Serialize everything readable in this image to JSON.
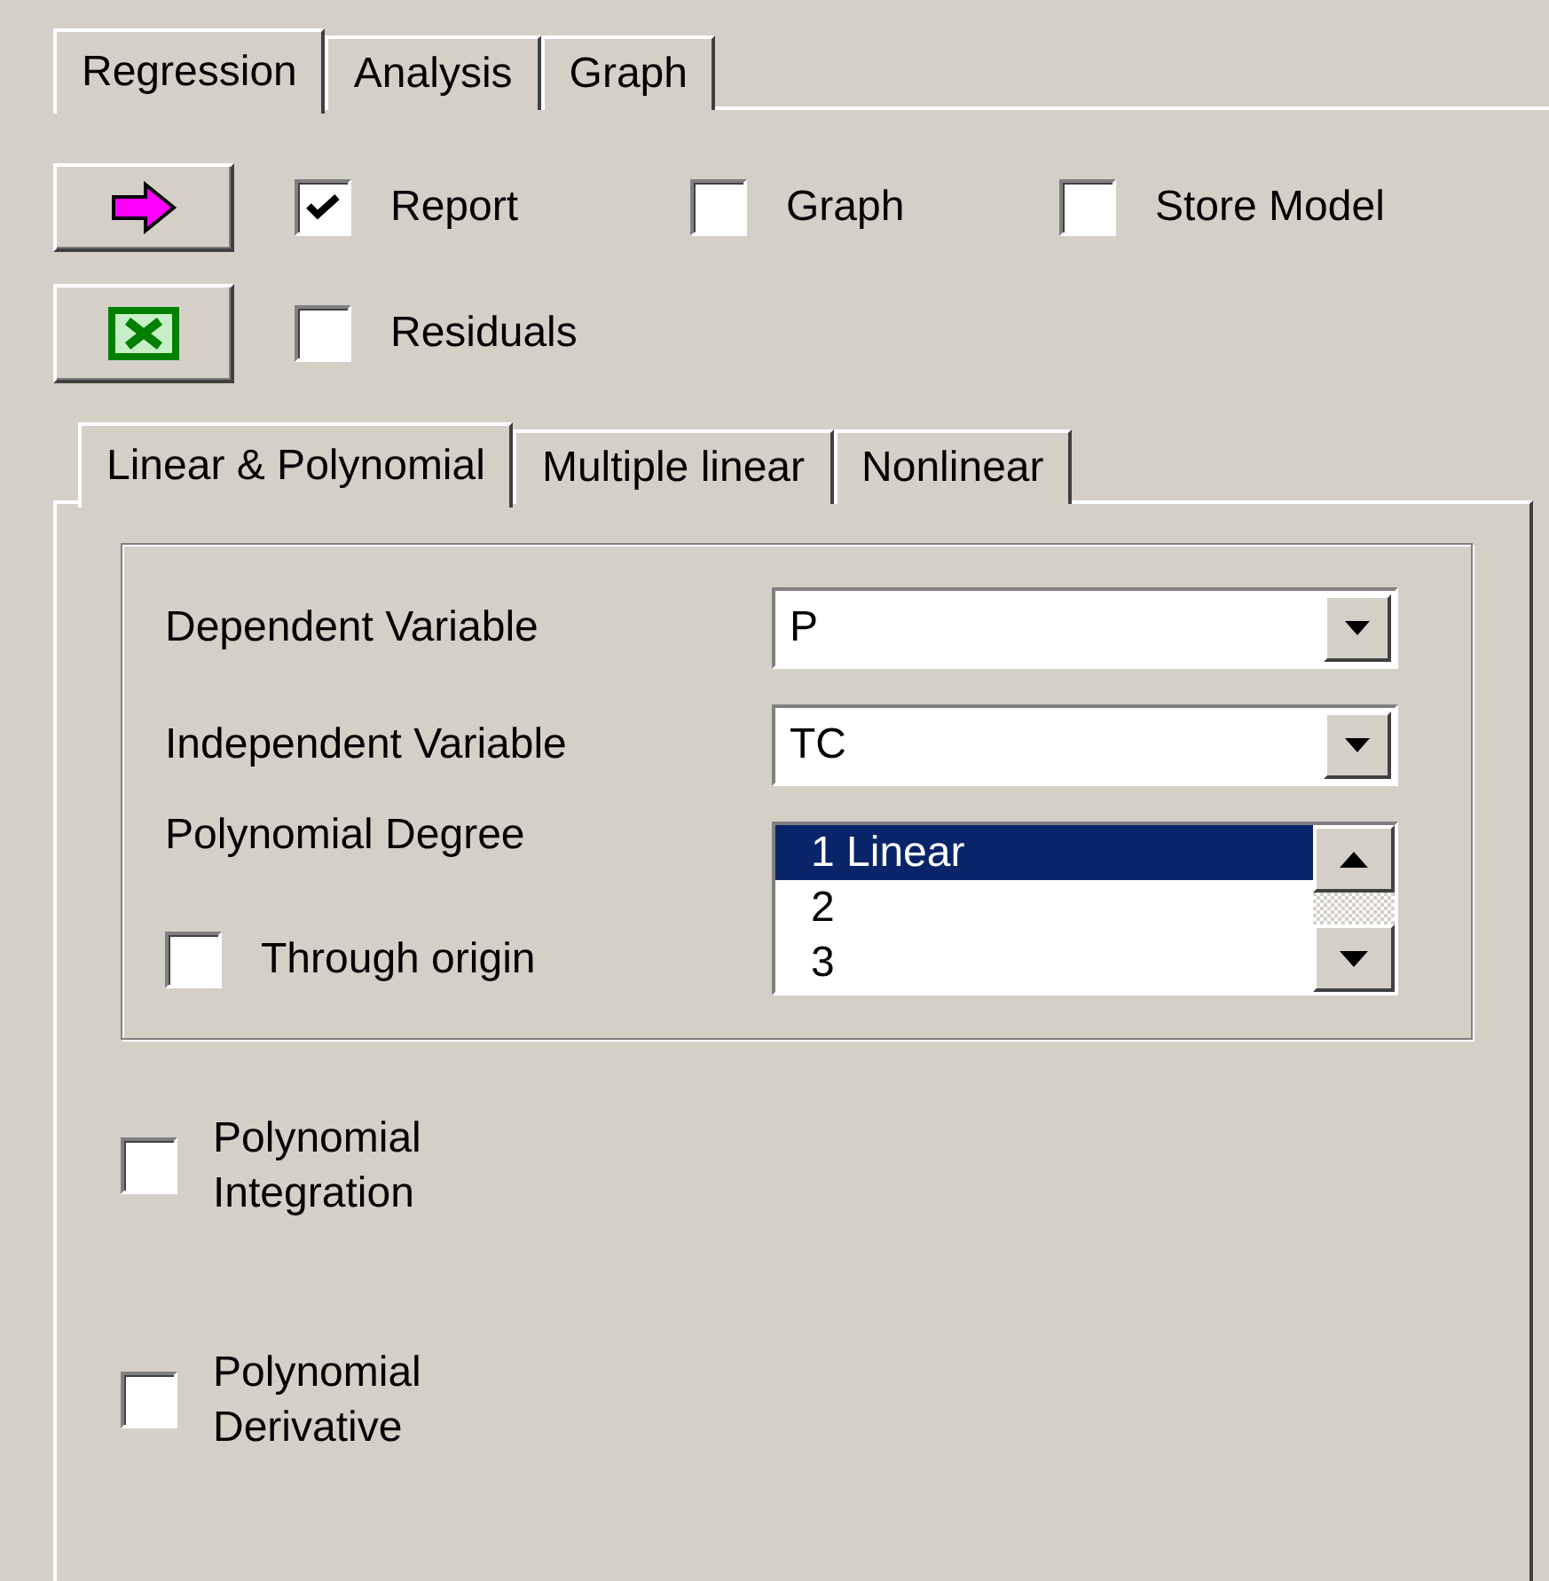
{
  "outer_tabs": [
    {
      "label": "Regression",
      "selected": true
    },
    {
      "label": "Analysis",
      "selected": false
    },
    {
      "label": "Graph",
      "selected": false
    }
  ],
  "action_buttons": [
    {
      "kind": "run"
    },
    {
      "kind": "export"
    }
  ],
  "options": [
    {
      "label": "Report",
      "checked": true
    },
    {
      "label": "Graph",
      "checked": false
    },
    {
      "label": "Store Model",
      "checked": false
    },
    {
      "label": "Residuals",
      "checked": false
    }
  ],
  "inner_tabs": [
    {
      "label": "Linear & Polynomial",
      "selected": true
    },
    {
      "label": "Multiple linear",
      "selected": false
    },
    {
      "label": "Nonlinear",
      "selected": false
    }
  ],
  "dependent_variable": {
    "label": "Dependent Variable",
    "value": "P"
  },
  "independent_variable": {
    "label": "Independent Variable",
    "value": "TC"
  },
  "polynomial_degree": {
    "label": "Polynomial Degree",
    "items": [
      {
        "label": "1 Linear",
        "selected": true
      },
      {
        "label": "2",
        "selected": false
      },
      {
        "label": "3",
        "selected": false
      }
    ]
  },
  "through_origin": {
    "label": "Through origin",
    "checked": false
  },
  "polynomial_options": [
    {
      "label": "Polynomial Integration",
      "checked": false
    },
    {
      "label": "Polynomial Derivative",
      "checked": false
    }
  ]
}
